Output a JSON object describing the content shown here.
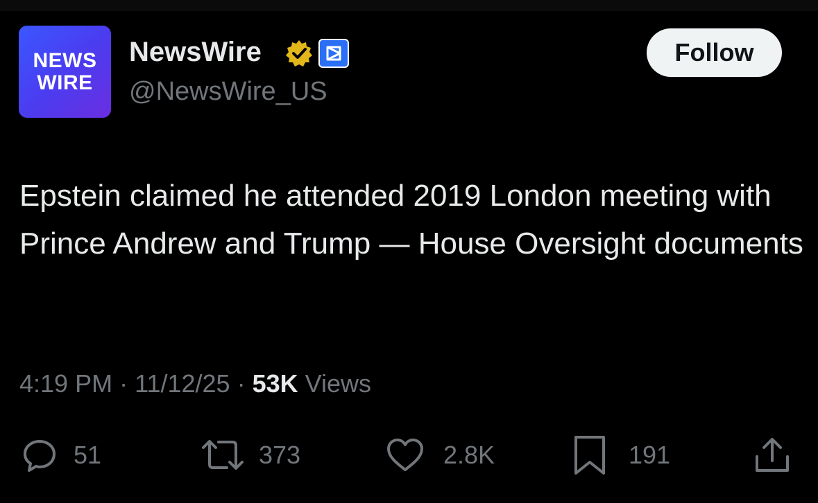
{
  "account": {
    "avatar_line1": "NEWS",
    "avatar_line2": "WIRE",
    "name": "NewsWire",
    "handle": "@NewsWire_US",
    "verified_icon": "verified-badge-gold",
    "affiliate_icon": "affiliate-badge"
  },
  "follow_label": "Follow",
  "tweet": {
    "text": "Epstein claimed he attended 2019 London meeting with Prince Andrew and Trump — House Oversight documents",
    "time": "4:19 PM",
    "date": "11/12/25",
    "views_count": "53K",
    "views_label": "Views",
    "separator": "·"
  },
  "actions": {
    "replies": "51",
    "reposts": "373",
    "likes": "2.8K",
    "bookmarks": "191"
  },
  "colors": {
    "background": "#000000",
    "text_primary": "#e7e9ea",
    "text_secondary": "#71767b",
    "follow_bg": "#eff3f4",
    "verified_gold": "#e2b719",
    "affiliate_blue": "#2b6ff7"
  }
}
